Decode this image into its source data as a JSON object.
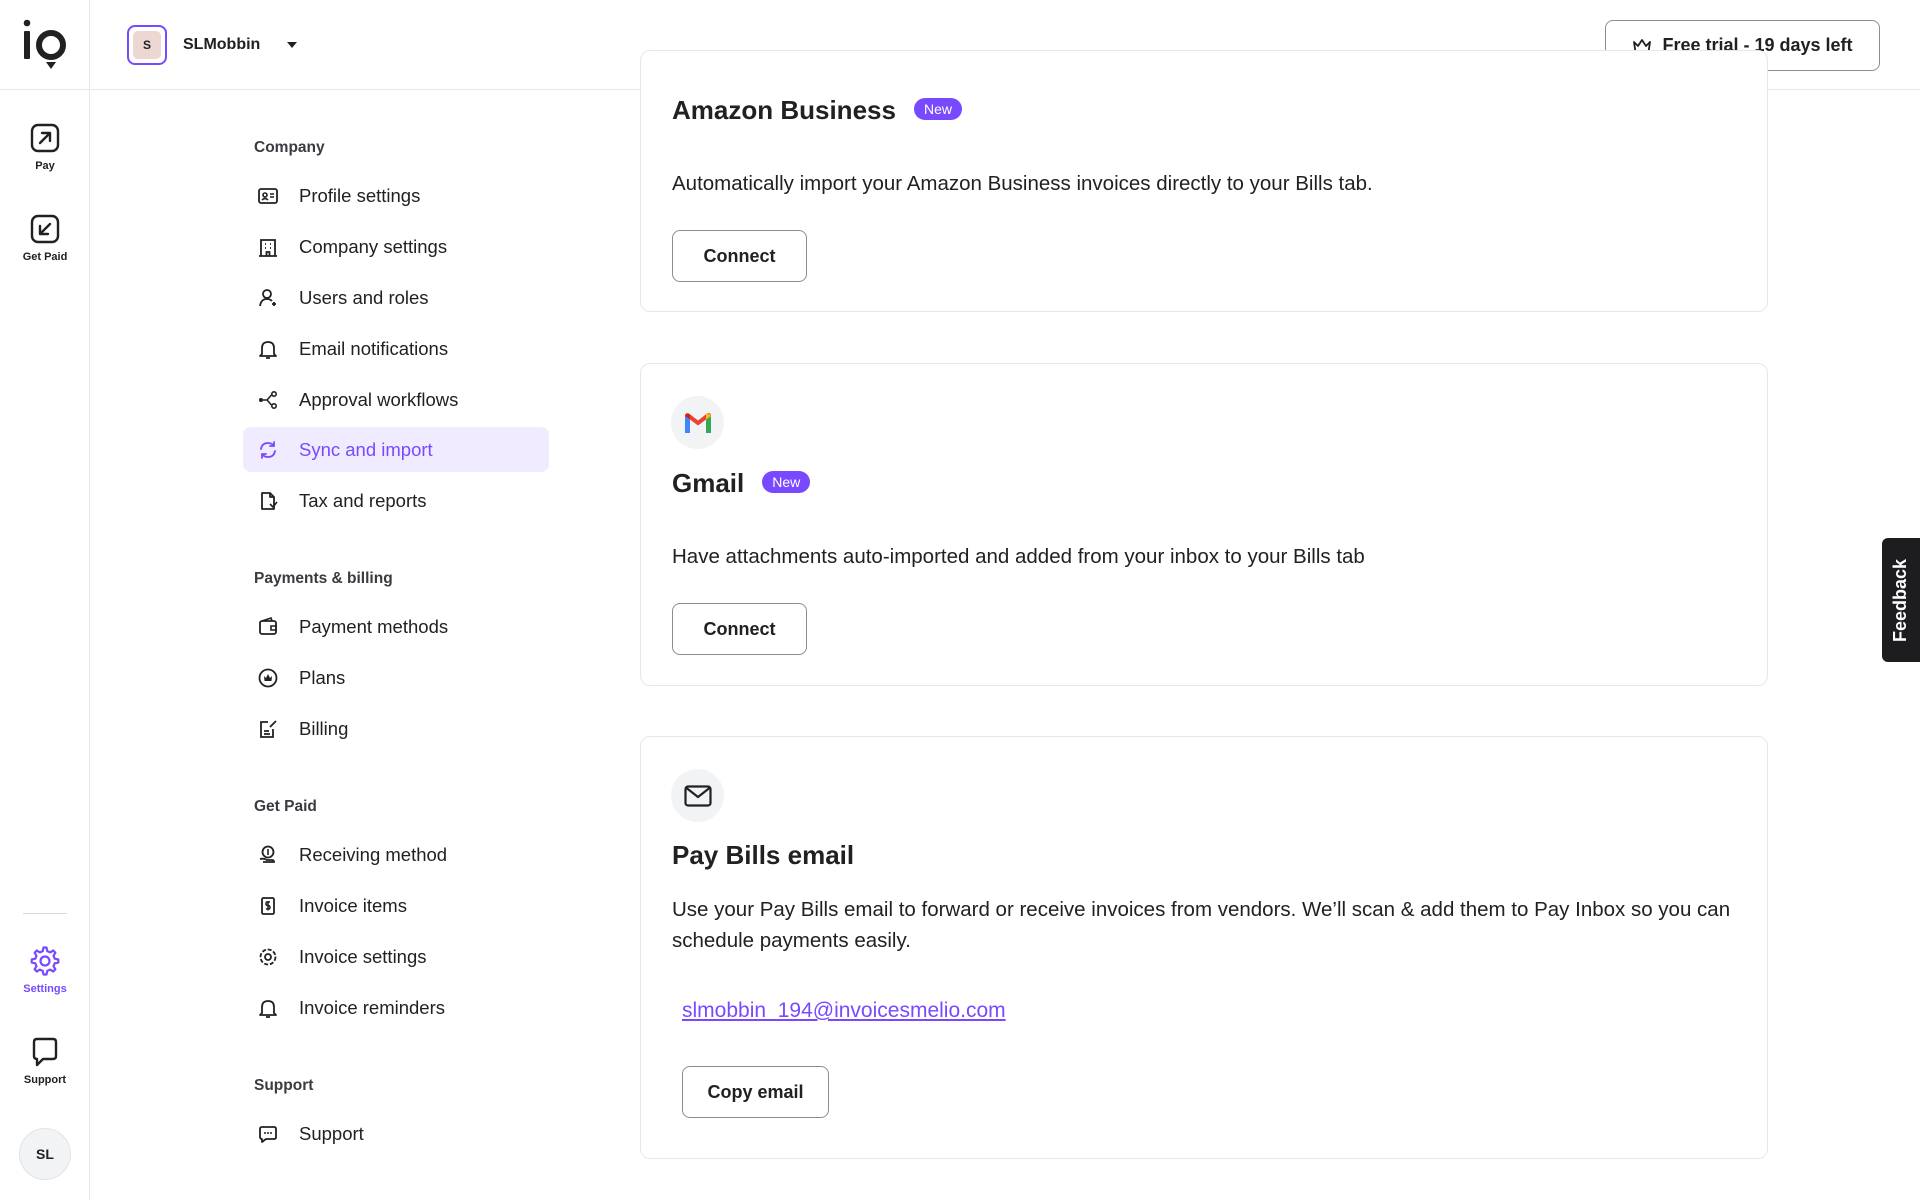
{
  "rail": {
    "items": [
      {
        "label": "Pay",
        "icon": "arrow-up-right-icon"
      },
      {
        "label": "Get Paid",
        "icon": "arrow-down-left-icon"
      },
      {
        "label": "Settings",
        "icon": "gear-icon"
      },
      {
        "label": "Support",
        "icon": "chat-icon"
      }
    ],
    "avatar": "SL"
  },
  "topbar": {
    "org_initial": "S",
    "org_name": "SLMobbin",
    "trial_label": "Free trial - 19 days left"
  },
  "nav": {
    "groups": [
      {
        "title": "Company",
        "items": [
          "Profile settings",
          "Company settings",
          "Users and roles",
          "Email notifications",
          "Approval workflows",
          "Sync and import",
          "Tax and reports"
        ]
      },
      {
        "title": "Payments & billing",
        "items": [
          "Payment methods",
          "Plans",
          "Billing"
        ]
      },
      {
        "title": "Get Paid",
        "items": [
          "Receiving method",
          "Invoice items",
          "Invoice settings",
          "Invoice reminders"
        ]
      },
      {
        "title": "Support",
        "items": [
          "Support"
        ]
      }
    ],
    "active": "Sync and import"
  },
  "cards": {
    "amazon": {
      "title": "Amazon Business",
      "badge": "New",
      "description": "Automatically import your Amazon Business invoices directly to your Bills tab.",
      "button": "Connect"
    },
    "gmail": {
      "title": "Gmail",
      "badge": "New",
      "description": "Have attachments auto-imported and added from your inbox to your Bills tab",
      "button": "Connect"
    },
    "paybills": {
      "title": "Pay Bills email",
      "description": "Use your Pay Bills email to forward or receive invoices from vendors. We’ll scan & add them to Pay Inbox so you can schedule payments easily.",
      "email": "slmobbin_194@invoicesmelio.com",
      "button": "Copy email"
    }
  },
  "feedback_label": "Feedback",
  "colors": {
    "accent": "#7849ff",
    "active_bg": "#f0ebff",
    "border": "#e4e7ec"
  }
}
